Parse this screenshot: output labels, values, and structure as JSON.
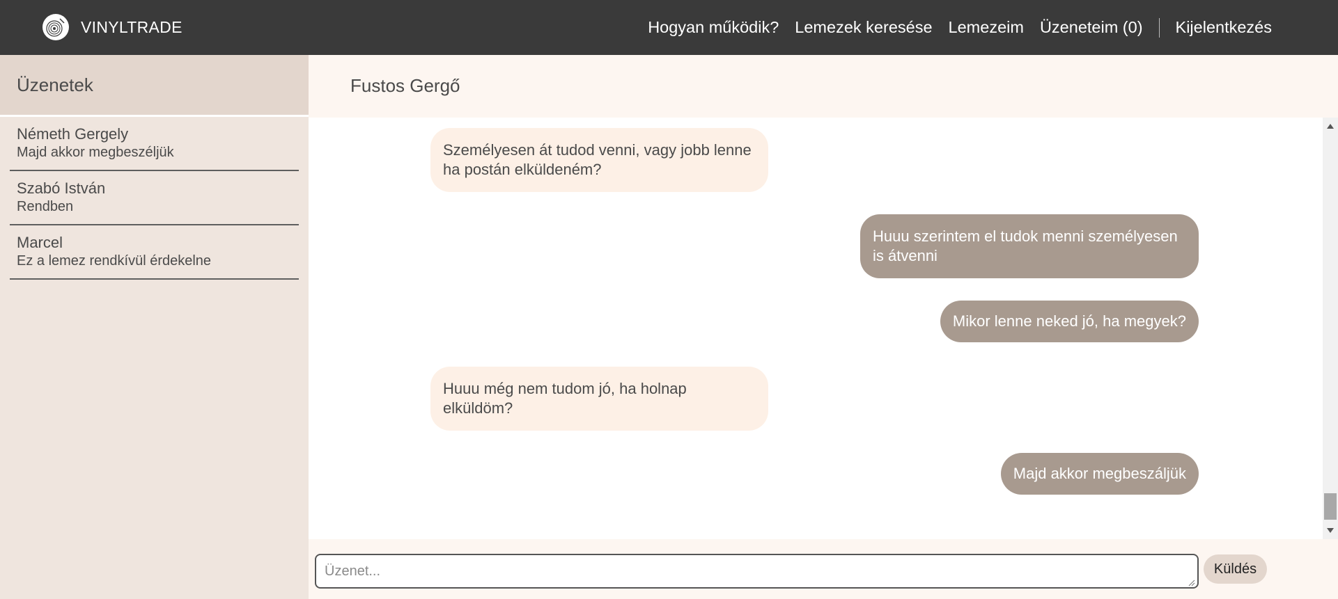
{
  "brand": {
    "name": "VINYLTRADE",
    "icon": "vinyl-record-icon"
  },
  "nav": {
    "how_it_works": "Hogyan működik?",
    "search_records": "Lemezek keresése",
    "my_records": "Lemezeim",
    "my_messages": "Üzeneteim (0)",
    "logout": "Kijelentkezés"
  },
  "sidebar": {
    "title": "Üzenetek",
    "conversations": [
      {
        "name": "Németh Gergely",
        "preview": "Majd akkor megbeszéljük"
      },
      {
        "name": "Szabó István",
        "preview": "Rendben"
      },
      {
        "name": "Marcel",
        "preview": "Ez a lemez rendkívül érdekelne"
      }
    ]
  },
  "chat": {
    "title": "Fustos Gergő",
    "messages": [
      {
        "direction": "incoming",
        "text": "Személyesen át tudod venni, vagy jobb lenne ha postán elküldeném?"
      },
      {
        "direction": "outgoing",
        "text": "Huuu szerintem el tudok menni személyesen is átvenni"
      },
      {
        "direction": "outgoing",
        "text": "Mikor lenne neked jó, ha megyek?"
      },
      {
        "direction": "incoming",
        "text": "Huuu még nem tudom jó, ha holnap elküldöm?"
      },
      {
        "direction": "outgoing",
        "text": "Majd akkor megbeszáljük"
      }
    ],
    "input_placeholder": "Üzenet...",
    "send_label": "Küldés"
  },
  "colors": {
    "navbar": "#3a3a3a",
    "sidebar_bg": "#efe5de",
    "sidebar_header": "#e3d6cd",
    "chat_bg": "#fdf6f1",
    "incoming_bubble": "#fdf0e6",
    "outgoing_bubble": "#a89a8f"
  }
}
